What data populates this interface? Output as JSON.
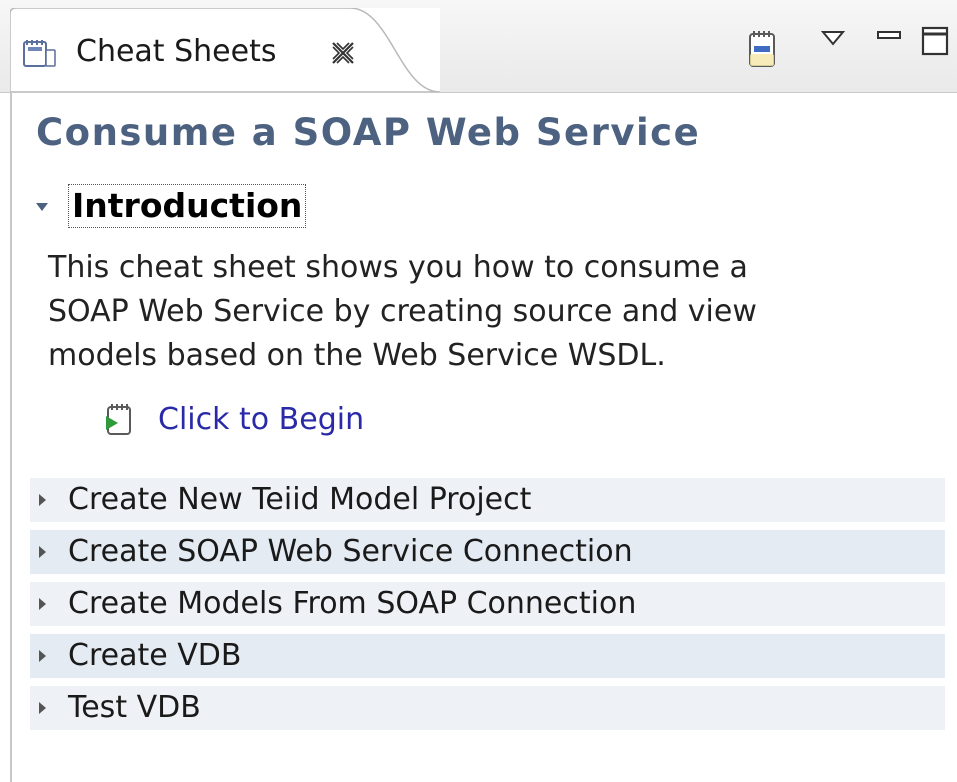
{
  "tab": {
    "title": "Cheat Sheets",
    "icon": "cheat-sheet-icon",
    "close_icon": "close-icon"
  },
  "toolbar": {
    "items": [
      "cheat-sheet-icon",
      "view-menu-icon",
      "minimize-icon",
      "maximize-icon"
    ]
  },
  "sheet": {
    "title": "Consume a SOAP Web Service",
    "intro": {
      "heading": "Introduction",
      "expanded": true,
      "lines": [
        "This cheat sheet shows you how to consume a",
        "SOAP Web Service by creating source and view",
        "models based on the Web Service WSDL."
      ],
      "begin_label": "Click to Begin"
    },
    "steps": [
      {
        "label": "Create New Teiid Model Project"
      },
      {
        "label": "Create SOAP Web Service Connection"
      },
      {
        "label": "Create Models From SOAP Connection"
      },
      {
        "label": "Create VDB"
      },
      {
        "label": "Test VDB"
      }
    ]
  },
  "colors": {
    "title": "#4d6180",
    "link": "#2a2aa8",
    "step_bg_a": "#eef2f7",
    "step_bg_b": "#e4ebf3"
  }
}
